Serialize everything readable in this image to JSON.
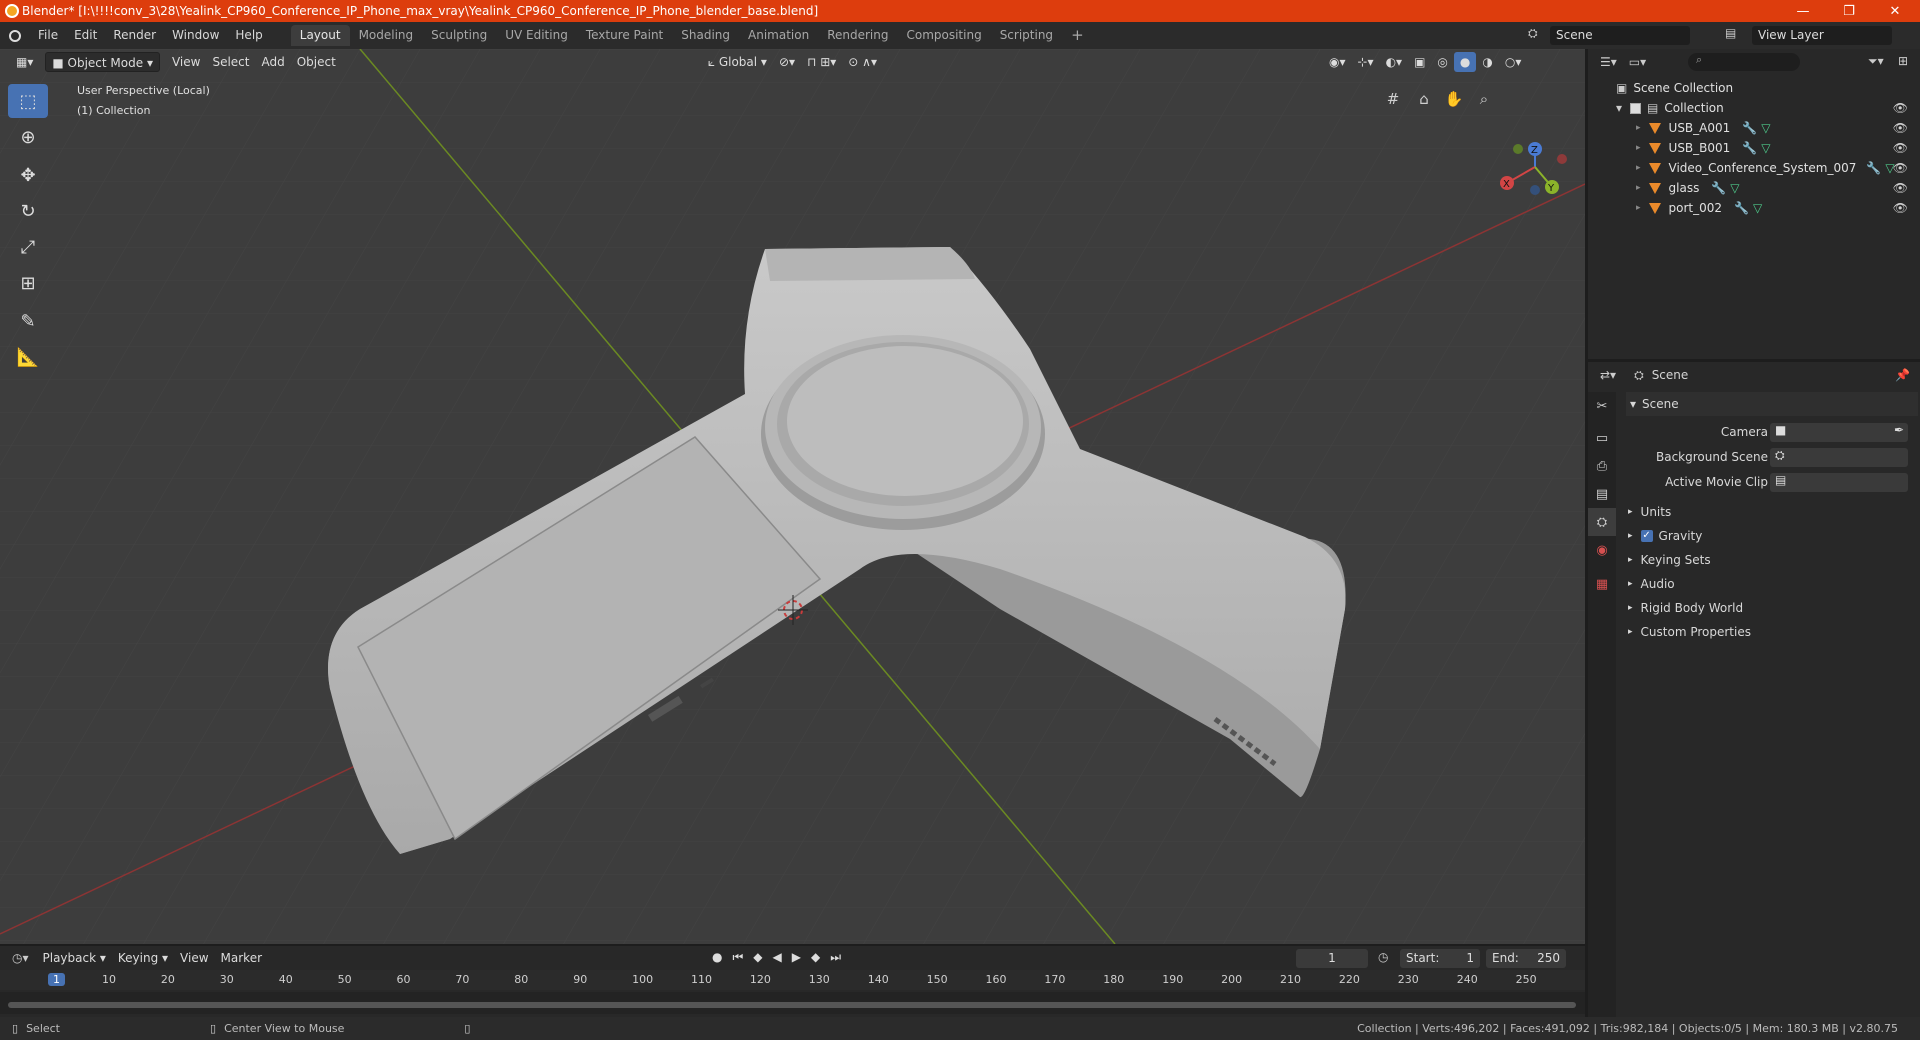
{
  "window": {
    "title": "Blender* [I:\\!!!!conv_3\\28\\Yealink_CP960_Conference_IP_Phone_max_vray\\Yealink_CP960_Conference_IP_Phone_blender_base.blend]",
    "minimize": "—",
    "maximize": "❐",
    "close": "✕"
  },
  "menu": [
    "File",
    "Edit",
    "Render",
    "Window",
    "Help"
  ],
  "workspaces": [
    "Layout",
    "Modeling",
    "Sculpting",
    "UV Editing",
    "Texture Paint",
    "Shading",
    "Animation",
    "Rendering",
    "Compositing",
    "Scripting"
  ],
  "workspace_add": "+",
  "scene_selector": "Scene",
  "view_layer_selector": "View Layer",
  "viewport": {
    "mode": "Object Mode",
    "menus": [
      "View",
      "Select",
      "Add",
      "Object"
    ],
    "orientation": "Global",
    "overlay_line1": "User Perspective (Local)",
    "overlay_line2": "(1) Collection",
    "gizmo": {
      "x": "X",
      "y": "Y",
      "z": "Z"
    }
  },
  "outliner": {
    "root": "Scene Collection",
    "collection": "Collection",
    "objects": [
      "USB_A001",
      "USB_B001",
      "Video_Conference_System_007",
      "glass",
      "port_002"
    ]
  },
  "properties": {
    "context": "Scene",
    "panel_title": "Scene",
    "fields": [
      "Camera",
      "Background Scene",
      "Active Movie Clip"
    ],
    "subpanels": [
      "Units",
      "Gravity",
      "Keying Sets",
      "Audio",
      "Rigid Body World",
      "Custom Properties"
    ]
  },
  "timeline": {
    "menus": [
      "Playback",
      "Keying",
      "View",
      "Marker"
    ],
    "current_frame": "1",
    "start_label": "Start:",
    "start": "1",
    "end_label": "End:",
    "end": "250",
    "ruler": [
      "1",
      "10",
      "20",
      "30",
      "40",
      "50",
      "60",
      "70",
      "80",
      "90",
      "100",
      "110",
      "120",
      "130",
      "140",
      "150",
      "160",
      "170",
      "180",
      "190",
      "200",
      "210",
      "220",
      "230",
      "240",
      "250"
    ]
  },
  "statusbar": {
    "left": "Select",
    "middle": "Center View to Mouse",
    "right": "Collection | Verts:496,202 | Faces:491,092 | Tris:982,184 | Objects:0/5 | Mem: 180.3 MB | v2.80.75"
  },
  "colors": {
    "accent": "#4772b3",
    "titlebar": "#dd3d0d",
    "object_orange": "#e98a2b"
  }
}
